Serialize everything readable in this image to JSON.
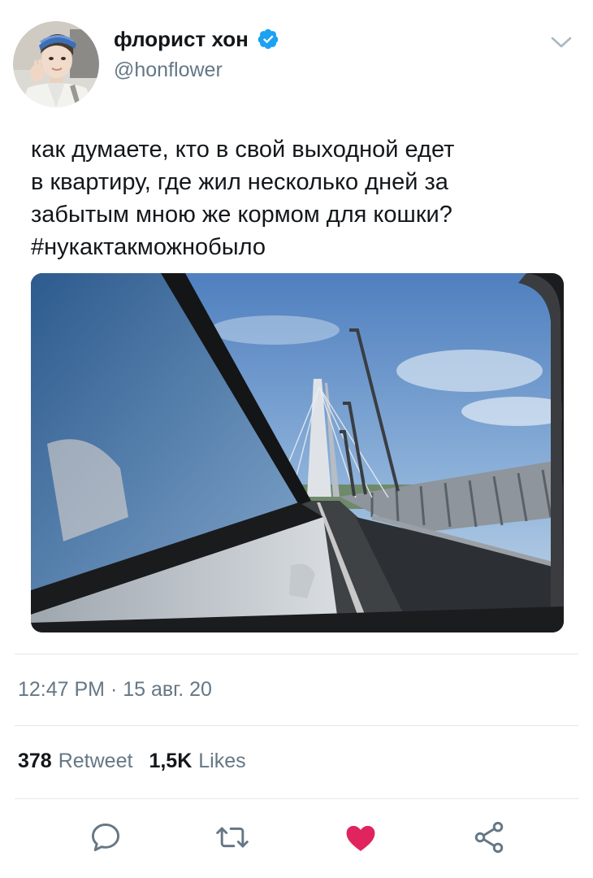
{
  "user": {
    "display_name": "флорист хон",
    "handle": "@honflower",
    "verified": true,
    "avatar_icon": "user-avatar"
  },
  "tweet": {
    "text_lines": [
      "как думаете, кто в свой выходной едет",
      "в квартиру, где жил несколько дней за",
      "забытым мною же кормом для кошки?",
      "#нукактакможнобыло"
    ],
    "timestamp": "12:47 PM · 15 авг. 20"
  },
  "stats": {
    "retweets_count": "378",
    "retweets_label": "Retweet",
    "likes_count": "1,5K",
    "likes_label": "Likes"
  },
  "actions": {
    "reply_icon": "reply-icon",
    "retweet_icon": "retweet-icon",
    "like_icon": "heart-icon",
    "share_icon": "share-icon",
    "like_active": true
  },
  "colors": {
    "verified": "#1da1f2",
    "like": "#e0245e",
    "secondary_text": "#657786",
    "icon_gray": "#657786"
  }
}
